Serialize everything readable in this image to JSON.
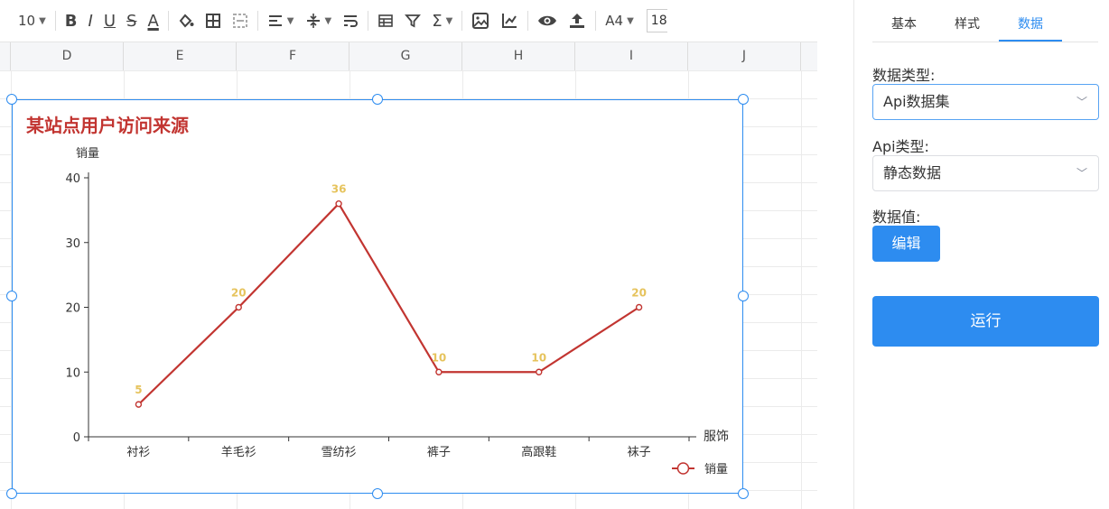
{
  "toolbar": {
    "font_size": "10",
    "paper": "A4",
    "font_size_box": "18"
  },
  "columns": [
    "D",
    "E",
    "F",
    "G",
    "H",
    "I",
    "J"
  ],
  "panel": {
    "tabs": [
      "基本",
      "样式",
      "数据"
    ],
    "active_tab": 2,
    "data_type_label": "数据类型:",
    "data_type_value": "Api数据集",
    "api_type_label": "Api类型:",
    "api_type_value": "静态数据",
    "data_value_label": "数据值:",
    "edit_label": "编辑",
    "run_label": "运行"
  },
  "colors": {
    "accent": "#2d8cf0",
    "series": "#c23531",
    "label": "#e6c35c"
  },
  "chart_data": {
    "type": "line",
    "title": "某站点用户访问来源",
    "xlabel": "服饰",
    "ylabel": "销量",
    "categories": [
      "衬衫",
      "羊毛衫",
      "雪纺衫",
      "裤子",
      "高跟鞋",
      "袜子"
    ],
    "series": [
      {
        "name": "销量",
        "values": [
          5,
          20,
          36,
          10,
          10,
          20
        ]
      }
    ],
    "ylim": [
      0,
      40
    ],
    "yticks": [
      0,
      10,
      20,
      30,
      40
    ],
    "legend": "bottom-right",
    "grid": false
  }
}
